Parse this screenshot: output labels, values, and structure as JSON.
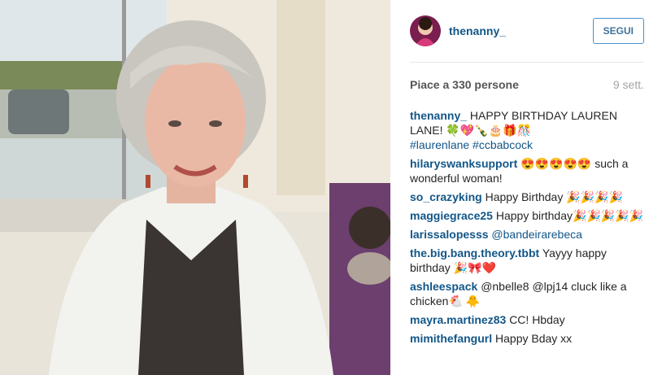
{
  "post": {
    "username": "thenanny_",
    "follow_label": "SEGUI",
    "likes": "Piace a 330 persone",
    "time_ago": "9 sett."
  },
  "comments": [
    {
      "user": "thenanny_",
      "text": "HAPPY BIRTHDAY LAUREN LANE! 🍀💖🍾🎂🎁🎊",
      "tags": "#laurenlane #ccbabcock"
    },
    {
      "user": "hilaryswanksupport",
      "text": "😍😍😍😍😍 such a wonderful woman!"
    },
    {
      "user": "so_crazyking",
      "text": "Happy Birthday 🎉🎉🎉🎉"
    },
    {
      "user": "maggiegrace25",
      "text": "Happy birthday🎉🎉🎉🎉🎉"
    },
    {
      "user": "larissalopesss",
      "text": "@bandeirarebeca"
    },
    {
      "user": "the.big.bang.theory.tbbt",
      "text": "Yayyy happy birthday 🎉🎀❤️"
    },
    {
      "user": "ashleespack",
      "text": "@nbelle8 @lpj14 cluck like a chicken🐔 🐥"
    },
    {
      "user": "mayra.martinez83",
      "text": "CC! Hbday"
    },
    {
      "user": "mimithefangurl",
      "text": "Happy Bday xx"
    }
  ],
  "colors": {
    "username_blue": "#125688",
    "follow_border": "#4a90c9",
    "divider": "#e6e6e6"
  }
}
